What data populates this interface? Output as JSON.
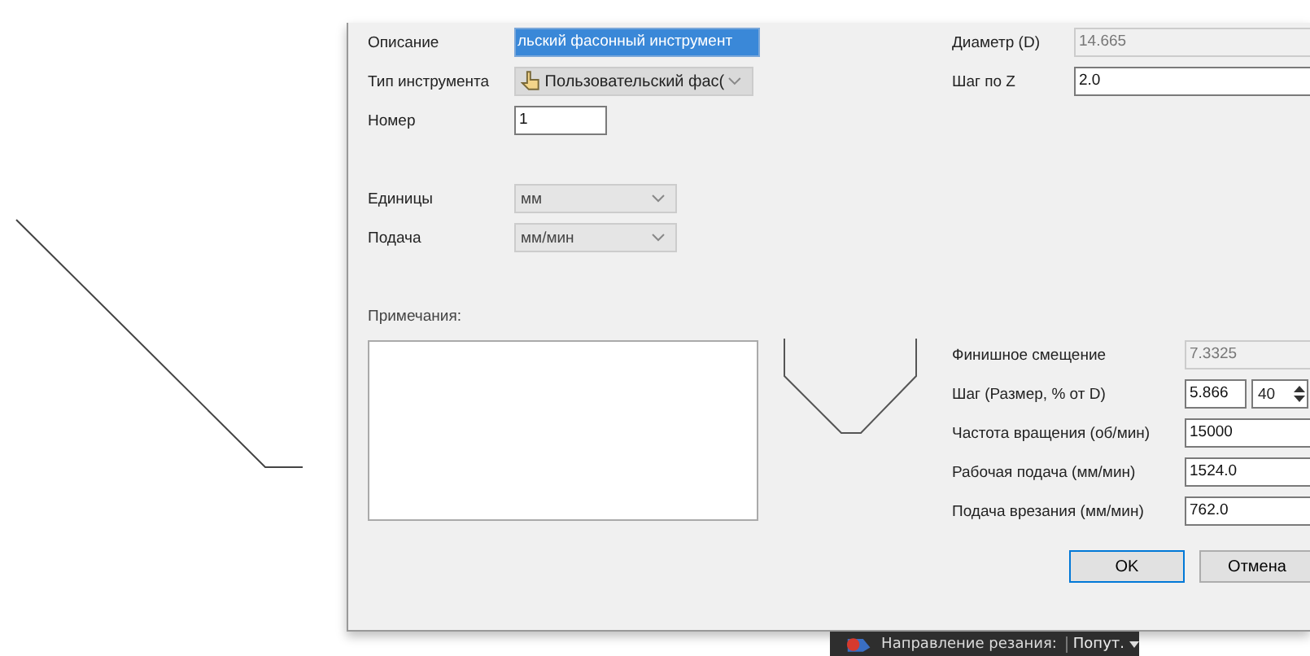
{
  "dialog": {
    "left_fields": [
      {
        "kind": "text",
        "label": "Описание",
        "value": "льский фасонный инструмент",
        "highlighted": true
      },
      {
        "kind": "combo",
        "label": "Тип инструмента",
        "value": "Пользовательский фас(",
        "icon": true,
        "disabled": true
      },
      {
        "kind": "text",
        "label": "Номер",
        "value": "1",
        "highlighted": false
      },
      {
        "kind": "spacer"
      },
      {
        "kind": "combo",
        "label": "Единицы",
        "value": "мм",
        "icon": false,
        "disabled": false
      },
      {
        "kind": "combo",
        "label": "Подача",
        "value": "мм/мин",
        "icon": false,
        "disabled": false
      }
    ],
    "notes": {
      "label": "Примечания:"
    },
    "right_top": [
      {
        "label": "Диаметр (D)",
        "value": "14.665",
        "disabled": true
      },
      {
        "label": "Шаг по Z",
        "value": "2.0",
        "disabled": false
      }
    ],
    "right_bottom": [
      {
        "kind": "text",
        "label": "Финишное смещение",
        "value": "7.3325",
        "disabled": true
      },
      {
        "kind": "spin",
        "label": "Шаг (Размер, % от D)",
        "value": "5.866",
        "percent": "40",
        "disabled": false
      },
      {
        "kind": "text",
        "label": "Частота вращения (об/мин)",
        "value": "15000",
        "disabled": false
      },
      {
        "kind": "text",
        "label": "Рабочая подача (мм/мин)",
        "value": "1524.0",
        "disabled": false
      },
      {
        "kind": "text",
        "label": "Подача врезания (мм/мин)",
        "value": "762.0",
        "disabled": false
      }
    ],
    "buttons": [
      {
        "label": "OK",
        "default": true
      },
      {
        "label": "Отмена",
        "default": false
      }
    ]
  },
  "status_bar": {
    "label": "Направление резания:",
    "value": "Попут."
  }
}
